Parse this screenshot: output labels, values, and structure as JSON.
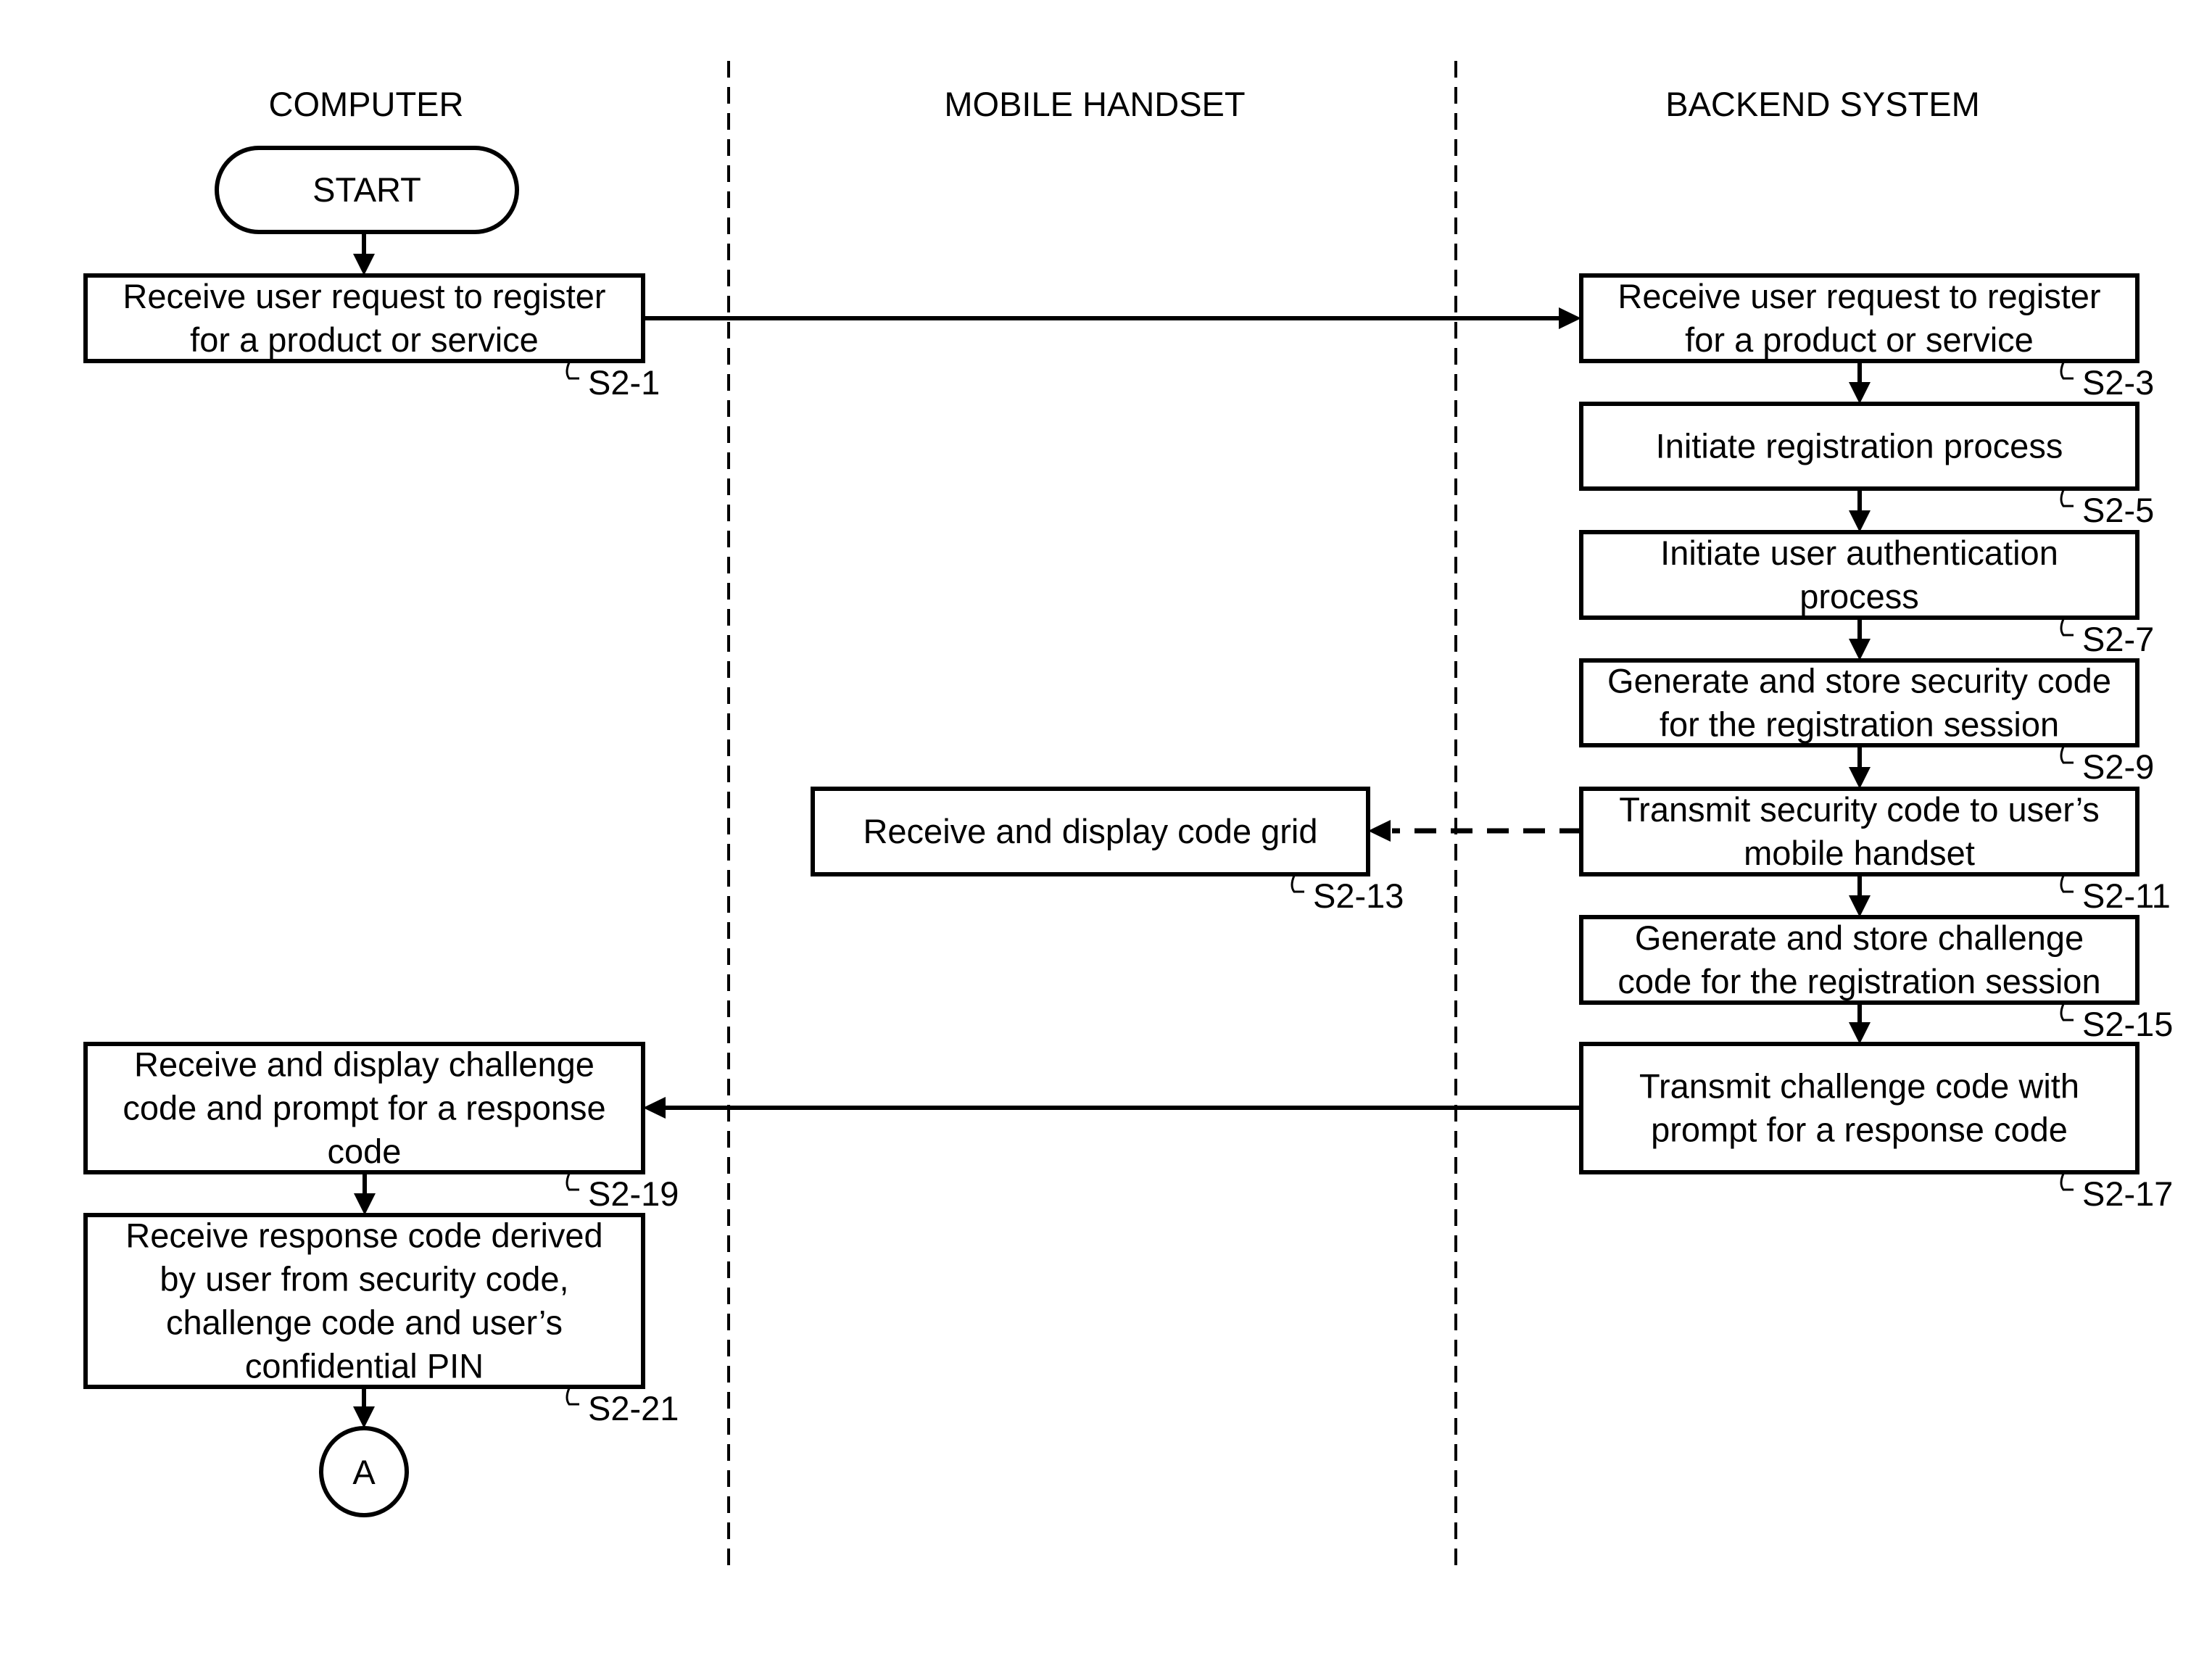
{
  "diagram": {
    "type": "swimlane-flowchart",
    "lanes": [
      {
        "id": "computer",
        "label": "COMPUTER"
      },
      {
        "id": "mobile",
        "label": "MOBILE HANDSET"
      },
      {
        "id": "backend",
        "label": "BACKEND SYSTEM"
      }
    ],
    "start": {
      "label": "START"
    },
    "connector": {
      "label": "A"
    },
    "steps": [
      {
        "id": "S2-1",
        "lane": "computer",
        "lines": [
          "Receive user request to register",
          "for a product or service"
        ]
      },
      {
        "id": "S2-3",
        "lane": "backend",
        "lines": [
          "Receive user request to register",
          "for a product or service"
        ]
      },
      {
        "id": "S2-5",
        "lane": "backend",
        "lines": [
          "Initiate registration process"
        ]
      },
      {
        "id": "S2-7",
        "lane": "backend",
        "lines": [
          "Initiate user authentication",
          "process"
        ]
      },
      {
        "id": "S2-9",
        "lane": "backend",
        "lines": [
          "Generate and store security code",
          "for the registration session"
        ]
      },
      {
        "id": "S2-11",
        "lane": "backend",
        "lines": [
          "Transmit security code to user’s",
          "mobile handset"
        ]
      },
      {
        "id": "S2-13",
        "lane": "mobile",
        "lines": [
          "Receive and display code grid"
        ]
      },
      {
        "id": "S2-15",
        "lane": "backend",
        "lines": [
          "Generate and store challenge",
          "code for the registration session"
        ]
      },
      {
        "id": "S2-17",
        "lane": "backend",
        "lines": [
          "Transmit challenge code with",
          "prompt for a response code"
        ]
      },
      {
        "id": "S2-19",
        "lane": "computer",
        "lines": [
          "Receive and display challenge",
          "code and prompt for a response",
          "code"
        ]
      },
      {
        "id": "S2-21",
        "lane": "computer",
        "lines": [
          "Receive response code derived",
          "by user from security code,",
          "challenge code and user’s",
          "confidential PIN"
        ]
      }
    ],
    "edges": [
      {
        "from": "START",
        "to": "S2-1",
        "style": "solid"
      },
      {
        "from": "S2-1",
        "to": "S2-3",
        "style": "solid"
      },
      {
        "from": "S2-3",
        "to": "S2-5",
        "style": "solid"
      },
      {
        "from": "S2-5",
        "to": "S2-7",
        "style": "solid"
      },
      {
        "from": "S2-7",
        "to": "S2-9",
        "style": "solid"
      },
      {
        "from": "S2-9",
        "to": "S2-11",
        "style": "solid"
      },
      {
        "from": "S2-11",
        "to": "S2-13",
        "style": "dashed"
      },
      {
        "from": "S2-11",
        "to": "S2-15",
        "style": "solid"
      },
      {
        "from": "S2-15",
        "to": "S2-17",
        "style": "solid"
      },
      {
        "from": "S2-17",
        "to": "S2-19",
        "style": "solid"
      },
      {
        "from": "S2-19",
        "to": "S2-21",
        "style": "solid"
      },
      {
        "from": "S2-21",
        "to": "A",
        "style": "solid"
      }
    ]
  }
}
